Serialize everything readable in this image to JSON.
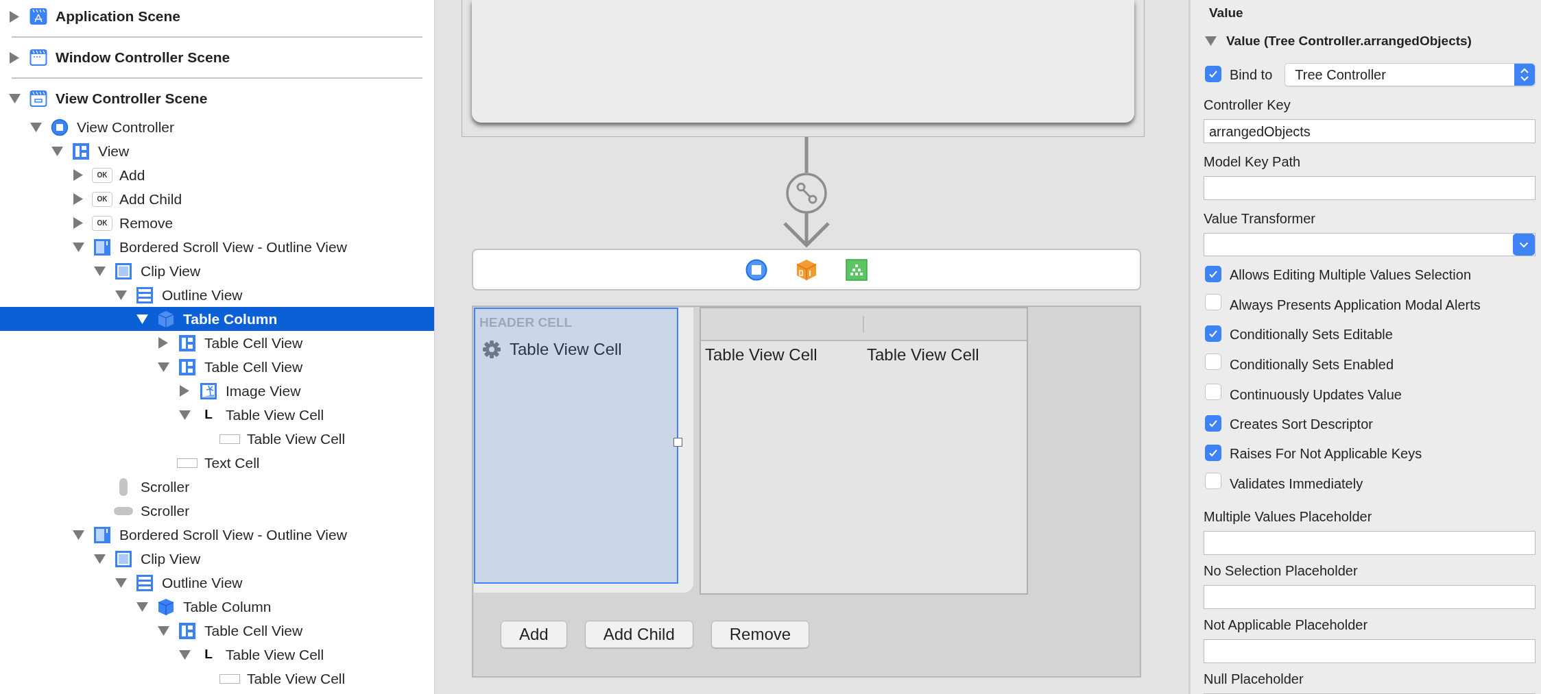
{
  "outline": {
    "scenes": [
      {
        "label": "Application Scene",
        "kind": "scene-app",
        "expanded": false,
        "selected": false
      },
      {
        "label": "Window Controller Scene",
        "kind": "scene-window",
        "expanded": false,
        "selected": false
      },
      {
        "label": "View Controller Scene",
        "kind": "scene-view",
        "expanded": true,
        "selected": false,
        "children": [
          {
            "label": "View Controller",
            "kind": "view-controller",
            "expanded": true,
            "selected": false,
            "children": [
              {
                "label": "View",
                "kind": "view",
                "expanded": true,
                "selected": false,
                "children": [
                  {
                    "label": "Add",
                    "kind": "button",
                    "icon_text": "OK",
                    "expanded": false,
                    "selected": false
                  },
                  {
                    "label": "Add Child",
                    "kind": "button",
                    "icon_text": "OK",
                    "expanded": false,
                    "selected": false
                  },
                  {
                    "label": "Remove",
                    "kind": "button",
                    "icon_text": "OK",
                    "expanded": false,
                    "selected": false
                  },
                  {
                    "label": "Bordered Scroll View - Outline View",
                    "kind": "scroll-view",
                    "expanded": true,
                    "selected": false,
                    "children": [
                      {
                        "label": "Clip View",
                        "kind": "clip-view",
                        "expanded": true,
                        "selected": false,
                        "children": [
                          {
                            "label": "Outline View",
                            "kind": "outline-view",
                            "expanded": true,
                            "selected": false,
                            "children": [
                              {
                                "label": "Table Column",
                                "kind": "table-column",
                                "expanded": true,
                                "selected": true,
                                "children": [
                                  {
                                    "label": "Table Cell View",
                                    "kind": "view",
                                    "expanded": false,
                                    "selected": false
                                  },
                                  {
                                    "label": "Table Cell View",
                                    "kind": "view",
                                    "expanded": true,
                                    "selected": false,
                                    "children": [
                                      {
                                        "label": "Image View",
                                        "kind": "image-view",
                                        "expanded": false,
                                        "selected": false
                                      },
                                      {
                                        "label": "Table View Cell",
                                        "kind": "label",
                                        "icon_text": "L",
                                        "expanded": true,
                                        "selected": false,
                                        "children": [
                                          {
                                            "label": "Table View Cell",
                                            "kind": "text-field",
                                            "selected": false
                                          }
                                        ]
                                      }
                                    ]
                                  },
                                  {
                                    "label": "Text Cell",
                                    "kind": "text-field",
                                    "selected": false
                                  }
                                ]
                              }
                            ]
                          }
                        ]
                      },
                      {
                        "label": "Scroller",
                        "kind": "scroller-v",
                        "selected": false
                      },
                      {
                        "label": "Scroller",
                        "kind": "scroller-h",
                        "selected": false
                      }
                    ]
                  },
                  {
                    "label": "Bordered Scroll View - Outline View",
                    "kind": "scroll-view",
                    "expanded": true,
                    "selected": false,
                    "children": [
                      {
                        "label": "Clip View",
                        "kind": "clip-view",
                        "expanded": true,
                        "selected": false,
                        "children": [
                          {
                            "label": "Outline View",
                            "kind": "outline-view",
                            "expanded": true,
                            "selected": false,
                            "children": [
                              {
                                "label": "Table Column",
                                "kind": "table-column",
                                "expanded": true,
                                "selected": false,
                                "children": [
                                  {
                                    "label": "Table Cell View",
                                    "kind": "view",
                                    "expanded": true,
                                    "selected": false,
                                    "children": [
                                      {
                                        "label": "Table View Cell",
                                        "kind": "label",
                                        "icon_text": "L",
                                        "expanded": true,
                                        "selected": false,
                                        "children": [
                                          {
                                            "label": "Table View Cell",
                                            "kind": "text-field",
                                            "selected": false
                                          }
                                        ]
                                      }
                                    ]
                                  }
                                ]
                              }
                            ]
                          }
                        ]
                      }
                    ]
                  }
                ]
              }
            ]
          }
        ]
      }
    ]
  },
  "canvas": {
    "table": {
      "header_cell": "HEADER CELL",
      "column_cell": "Table View Cell",
      "cells": [
        "Table View Cell",
        "Table View Cell"
      ]
    },
    "buttons": [
      "Add",
      "Add Child",
      "Remove"
    ]
  },
  "inspector": {
    "title": "Value",
    "group": {
      "title": "Value (Tree Controller.arrangedObjects)",
      "expanded": true
    },
    "bind_to": {
      "label": "Bind to",
      "checked": true,
      "value": "Tree Controller"
    },
    "fields": [
      {
        "label": "Controller Key",
        "kind": "text",
        "value": "arrangedObjects"
      },
      {
        "label": "Model Key Path",
        "kind": "text"
      },
      {
        "label": "Value Transformer",
        "kind": "combo"
      }
    ],
    "options": [
      {
        "label": "Allows Editing Multiple Values Selection",
        "checked": true
      },
      {
        "label": "Always Presents Application Modal Alerts",
        "checked": false
      },
      {
        "label": "Conditionally Sets Editable",
        "checked": true
      },
      {
        "label": "Conditionally Sets Enabled",
        "checked": false
      },
      {
        "label": "Continuously Updates Value",
        "checked": false
      },
      {
        "label": "Creates Sort Descriptor",
        "checked": true
      },
      {
        "label": "Raises For Not Applicable Keys",
        "checked": true
      },
      {
        "label": "Validates Immediately",
        "checked": false
      }
    ],
    "placeholders": [
      {
        "label": "Multiple Values Placeholder",
        "kind": "text"
      },
      {
        "label": "No Selection Placeholder",
        "kind": "text"
      },
      {
        "label": "Not Applicable Placeholder",
        "kind": "text"
      },
      {
        "label": "Null Placeholder",
        "kind": "text"
      }
    ]
  }
}
